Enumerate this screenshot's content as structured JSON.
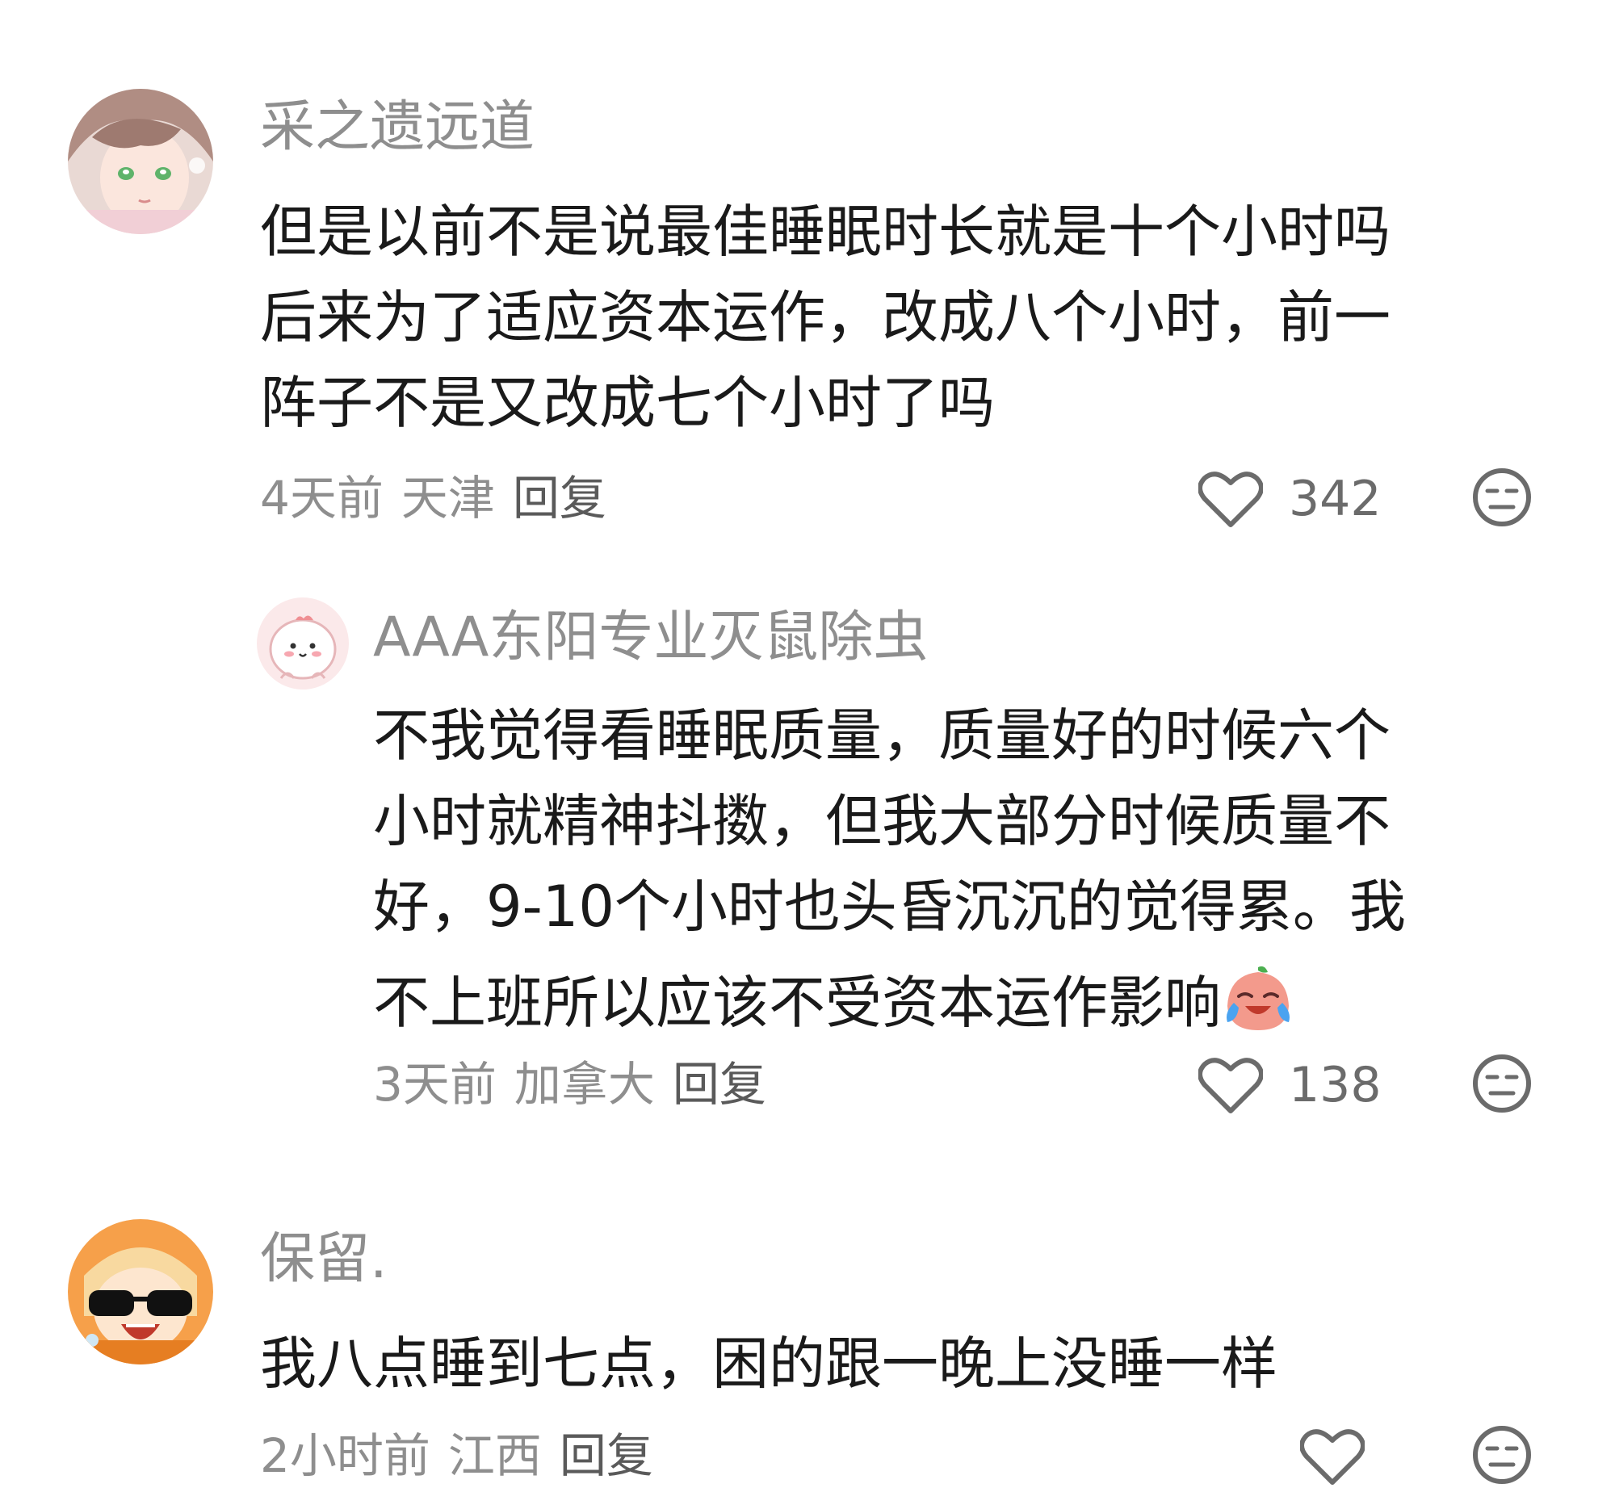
{
  "comments": [
    {
      "username": "采之遗远道",
      "lines": [
        "但是以前不是说最佳睡眠时长就是十个小时吗",
        "后来为了适应资本运作，改成八个小时，前一",
        "阵子不是又改成七个小时了吗"
      ],
      "time": "4天前",
      "location": "天津",
      "reply_label": "回复",
      "likes": "342"
    },
    {
      "username": "AAA东阳专业灭鼠除虫",
      "lines": [
        "不我觉得看睡眠质量，质量好的时候六个",
        "小时就精神抖擞，但我大部分时候质量不",
        "好，9-10个小时也头昏沉沉的觉得累。我",
        "不上班所以应该不受资本运作影响"
      ],
      "time": "3天前",
      "location": "加拿大",
      "reply_label": "回复",
      "likes": "138"
    },
    {
      "username": "保留.",
      "lines": [
        "我八点睡到七点，困的跟一晚上没睡一样"
      ],
      "time": "2小时前",
      "location": "江西",
      "reply_label": "回复",
      "likes": ""
    }
  ],
  "icons": {
    "like": "heart-outline-icon",
    "dislike": "meh-face-icon",
    "inline_emoji": "crying-laughing-peach-emoji"
  },
  "colors": {
    "text": "#1a1a1a",
    "muted": "#8e8e8e",
    "icon": "#6b6b6b"
  }
}
